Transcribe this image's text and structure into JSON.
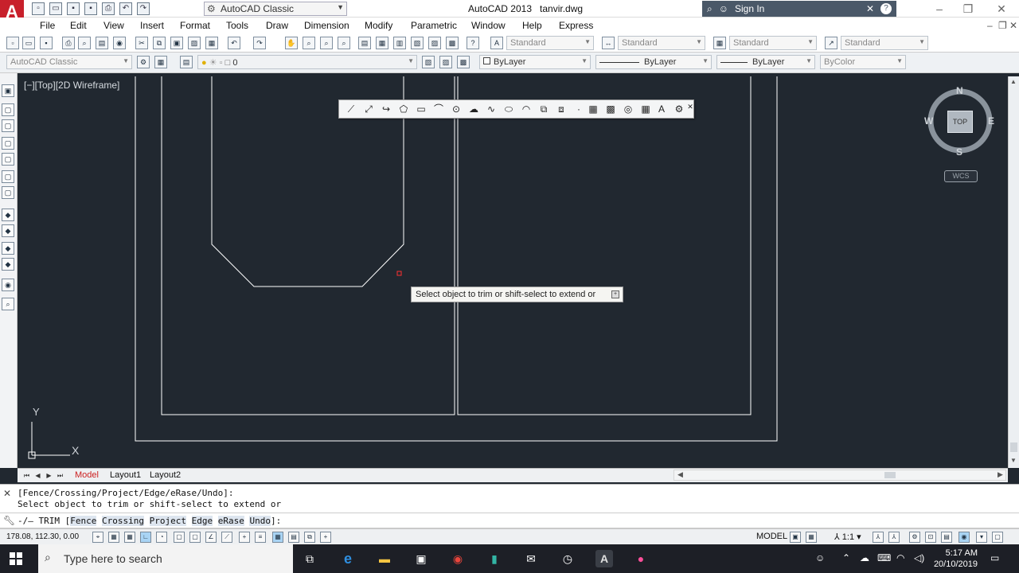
{
  "titlebar": {
    "workspace": "AutoCAD Classic",
    "app_title": "AutoCAD 2013",
    "file_name": "tanvir.dwg",
    "sign_in": "Sign In",
    "help": "?"
  },
  "menu": [
    "File",
    "Edit",
    "View",
    "Insert",
    "Format",
    "Tools",
    "Draw",
    "Dimension",
    "Modify",
    "Parametric",
    "Window",
    "Help",
    "Express"
  ],
  "styles_toolbar": {
    "text_style": "Standard",
    "dim_style": "Standard",
    "table_style": "Standard",
    "mleader_style": "Standard"
  },
  "properties_toolbar": {
    "workspace": "AutoCAD Classic",
    "layer": "0",
    "color": "ByLayer",
    "linetype": "ByLayer",
    "lineweight": "ByLayer",
    "plotstyle": "ByColor"
  },
  "viewport": {
    "label": "[−][Top][2D Wireframe]"
  },
  "viewcube": {
    "north": "N",
    "south": "S",
    "east": "E",
    "west": "W",
    "face": "TOP",
    "ucs": "WCS"
  },
  "ucs_icon": {
    "x": "X",
    "y": "Y"
  },
  "tooltip": {
    "text": "Select object to trim or shift-select to extend or"
  },
  "layout_tabs": [
    "Model",
    "Layout1",
    "Layout2"
  ],
  "command_history": [
    "[Fence/Crossing/Project/Edge/eRase/Undo]:",
    "Select object to trim or shift-select to extend or"
  ],
  "command_line": {
    "prefix": "-/– TRIM [",
    "options": [
      "Fence",
      "Crossing",
      "Project",
      "Edge",
      "eRase",
      "Undo"
    ],
    "suffix": "]:"
  },
  "statusbar": {
    "coordinates": "178.08, 112.30, 0.00",
    "space": "MODEL",
    "annotation_scale": "1:1"
  },
  "taskbar": {
    "search_placeholder": "Type here to search",
    "time": "5:17 AM",
    "date": "20/10/2019"
  },
  "colors": {
    "canvas": "#212830",
    "geometry": "#ffffff",
    "accent_red": "#c8202b",
    "active_tab": "#cc2020"
  }
}
